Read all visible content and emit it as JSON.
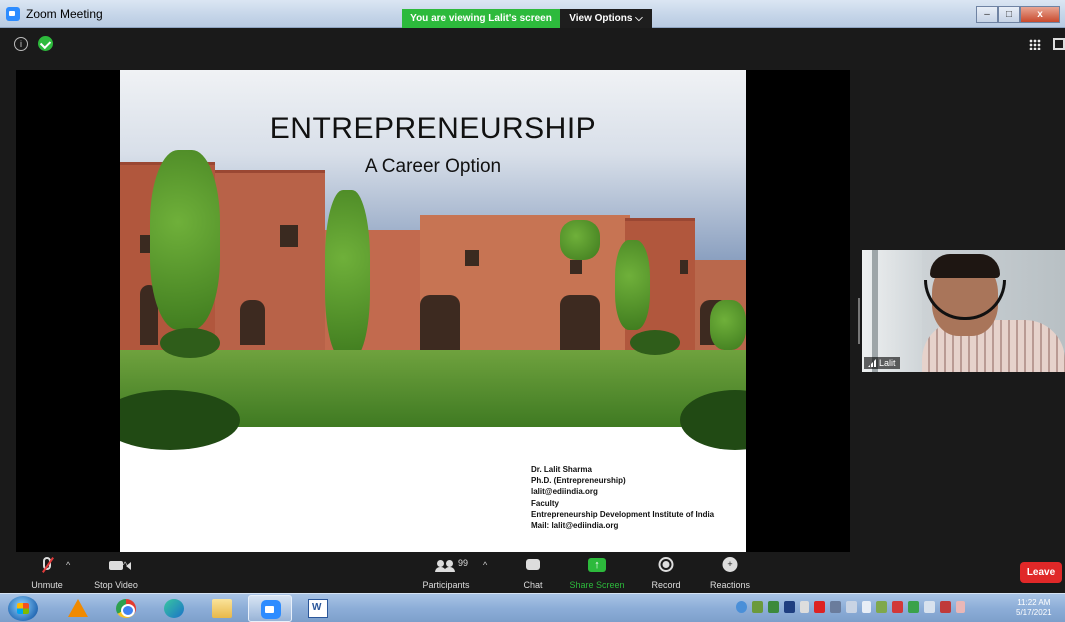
{
  "window": {
    "title": "Zoom Meeting",
    "viewing_banner": "You are viewing Lalit's screen",
    "view_options": "View Options ⌵",
    "minimize": "–",
    "maximize": "□",
    "close": "x"
  },
  "meeting": {
    "info_glyph": "i"
  },
  "slide": {
    "title": "ENTREPRENEURSHIP",
    "subtitle": "A Career Option",
    "credits": [
      "Dr. Lalit Sharma",
      "Ph.D. (Entrepreneurship)",
      "lalit@ediindia.org",
      "Faculty",
      "Entrepreneurship Development Institute of India",
      "Mail: lalit@ediindia.org"
    ]
  },
  "video": {
    "participant_name": "Lalit"
  },
  "toolbar": {
    "unmute": "Unmute",
    "stop_video": "Stop Video",
    "participants": "Participants",
    "participants_count": "99",
    "chat": "Chat",
    "share_screen": "Share Screen",
    "share_glyph": "↑",
    "record": "Record",
    "reactions": "Reactions",
    "reactions_glyph": "+",
    "caret": "^",
    "leave": "Leave",
    "share_color": "#2dba3c",
    "leave_color": "#e02828"
  },
  "taskbar": {
    "apps": [
      "vlc-icon",
      "chrome-icon",
      "edge-icon",
      "file-explorer-icon",
      "zoom-icon",
      "word-icon"
    ],
    "clock_time": "11:22 AM",
    "clock_date": "5/17/2021"
  }
}
